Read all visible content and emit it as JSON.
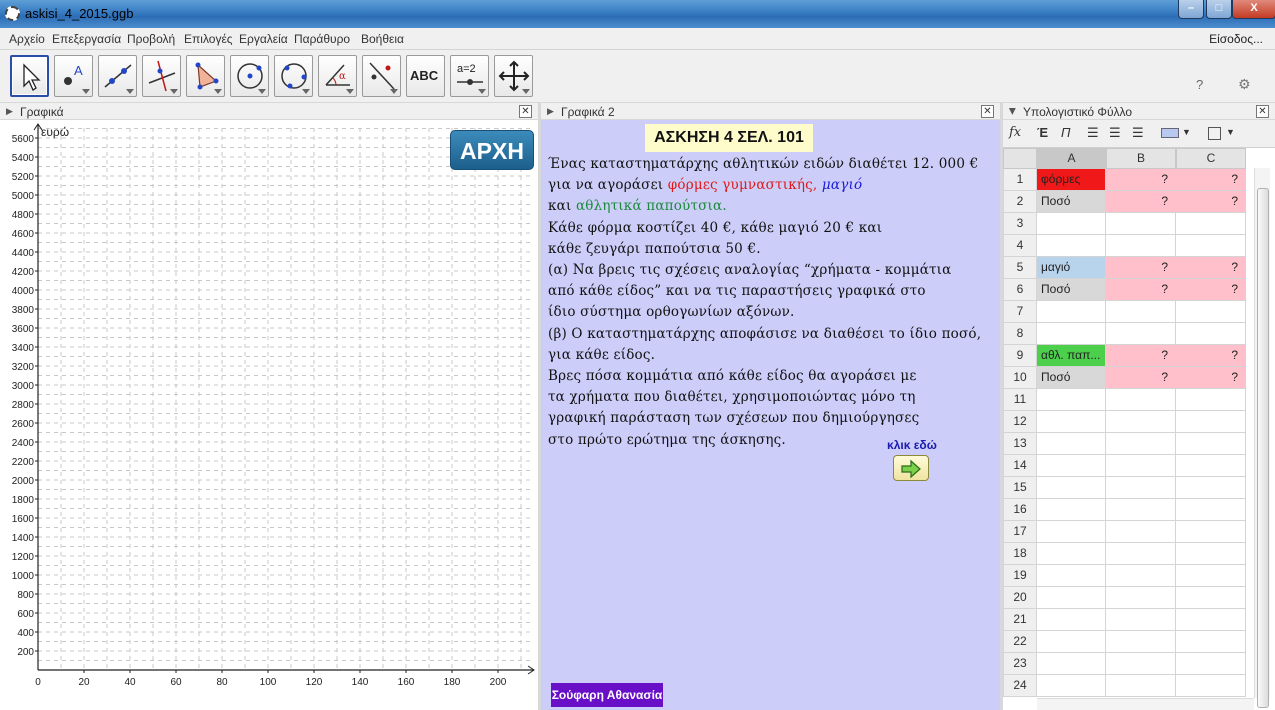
{
  "window": {
    "title": "askisi_4_2015.ggb",
    "minimize": "–",
    "maximize": "□",
    "close": "X"
  },
  "menu": {
    "items": [
      "Αρχείο",
      "Επεξεργασία",
      "Προβολή",
      "Επιλογές",
      "Εργαλεία",
      "Παράθυρο",
      "Βοήθεια"
    ],
    "login": "Είσοδος..."
  },
  "toolbar": {
    "tools": [
      "move-tool",
      "point-tool",
      "line-tool",
      "perpendicular-line-tool",
      "polygon-tool",
      "circle-tool",
      "conic-tool",
      "angle-tool",
      "reflect-tool",
      "text-tool",
      "slider-tool",
      "move-graphics-view-tool"
    ],
    "text_tool_label": "ABC",
    "slider_tool_label": "a=2",
    "angle_label": "α",
    "help": "?",
    "undo": "↶",
    "redo": "↷"
  },
  "graphics1": {
    "title": "Γραφικά",
    "y_label": "ευρώ",
    "home_button": "ΑΡΧΗ",
    "y_ticks": [
      5600,
      5400,
      5200,
      5000,
      4800,
      4600,
      4400,
      4200,
      4000,
      3800,
      3600,
      3400,
      3200,
      3000,
      2800,
      2600,
      2400,
      2200,
      2000,
      1800,
      1600,
      1400,
      1200,
      1000,
      800,
      600,
      400,
      200
    ],
    "x_ticks": [
      0,
      20,
      40,
      60,
      80,
      100,
      120,
      140,
      160,
      180,
      200
    ]
  },
  "graphics2": {
    "title": "Γραφικά 2",
    "exercise_title": "ΑΣΚΗΣΗ 4    ΣΕΛ. 101",
    "lines": [
      "Ένας καταστηματάρχης αθλητικών ειδών διαθέτει 12. 000 €",
      "για να αγοράσει ",
      "φόρμες γυμναστικής, ",
      "μαγιό",
      "και ",
      "αθλητικά παπούτσια.",
      "Κάθε φόρμα κοστίζει 40 €, κάθε μαγιό 20 € και",
      "κάθε ζευγάρι παπούτσια 50 €.",
      "(α)  Να βρεις τις σχέσεις αναλογίας “χρήματα - κομμάτια",
      "από κάθε είδος” και να τις παραστήσεις γραφικά στο",
      "ίδιο σύστημα ορθογωνίων αξόνων.",
      "(β)  Ο καταστηματάρχης αποφάσισε να διαθέσει το ίδιο ποσό,",
      "για κάθε είδος.",
      "Βρες πόσα κομμάτια από κάθε είδος θα αγοράσει με",
      "τα χρήματα που διαθέτει, χρησιμοποιώντας μόνο τη",
      "γραφική παράσταση των σχέσεων που δημιούργησες",
      "στο πρώτο ερώτημα της άσκησης."
    ],
    "click_label": "κλικ εδώ",
    "author": "Σούφαρη Αθανασία"
  },
  "spreadsheet": {
    "title": "Υπολογιστικό Φύλλο",
    "toolbar_fx": "fx",
    "bold": "Έ",
    "italic": "Π",
    "columns": [
      "A",
      "B",
      "C"
    ],
    "rows": [
      {
        "n": "1",
        "a": "φόρμες",
        "b": "?",
        "c": "?",
        "a_color": "#f01818",
        "bc_color": "#ffc0cb"
      },
      {
        "n": "2",
        "a": "Ποσό",
        "b": "?",
        "c": "?",
        "a_color": "#d8d8d8",
        "bc_color": "#ffc0cb"
      },
      {
        "n": "3",
        "a": "",
        "b": "",
        "c": ""
      },
      {
        "n": "4",
        "a": "",
        "b": "",
        "c": ""
      },
      {
        "n": "5",
        "a": "μαγιό",
        "b": "?",
        "c": "?",
        "a_color": "#b8d4ec",
        "bc_color": "#ffc0cb"
      },
      {
        "n": "6",
        "a": "Ποσό",
        "b": "?",
        "c": "?",
        "a_color": "#d8d8d8",
        "bc_color": "#ffc0cb"
      },
      {
        "n": "7",
        "a": "",
        "b": "",
        "c": ""
      },
      {
        "n": "8",
        "a": "",
        "b": "",
        "c": ""
      },
      {
        "n": "9",
        "a": "αθλ. παπ...",
        "b": "?",
        "c": "?",
        "a_color": "#4cd04c",
        "bc_color": "#ffc0cb"
      },
      {
        "n": "10",
        "a": "Ποσό",
        "b": "?",
        "c": "?",
        "a_color": "#d8d8d8",
        "bc_color": "#ffc0cb"
      },
      {
        "n": "11",
        "a": "",
        "b": "",
        "c": ""
      },
      {
        "n": "12",
        "a": "",
        "b": "",
        "c": ""
      },
      {
        "n": "13",
        "a": "",
        "b": "",
        "c": ""
      },
      {
        "n": "14",
        "a": "",
        "b": "",
        "c": ""
      },
      {
        "n": "15",
        "a": "",
        "b": "",
        "c": ""
      },
      {
        "n": "16",
        "a": "",
        "b": "",
        "c": ""
      },
      {
        "n": "17",
        "a": "",
        "b": "",
        "c": ""
      },
      {
        "n": "18",
        "a": "",
        "b": "",
        "c": ""
      },
      {
        "n": "19",
        "a": "",
        "b": "",
        "c": ""
      },
      {
        "n": "20",
        "a": "",
        "b": "",
        "c": ""
      },
      {
        "n": "21",
        "a": "",
        "b": "",
        "c": ""
      },
      {
        "n": "22",
        "a": "",
        "b": "",
        "c": ""
      },
      {
        "n": "23",
        "a": "",
        "b": "",
        "c": ""
      },
      {
        "n": "24",
        "a": "",
        "b": "",
        "c": ""
      }
    ]
  }
}
